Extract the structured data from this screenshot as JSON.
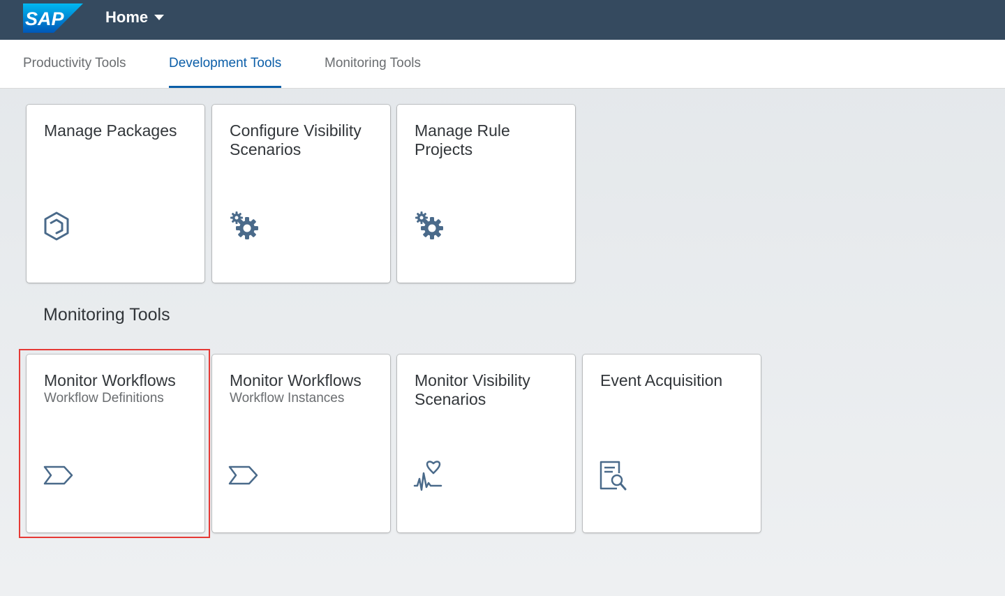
{
  "shell": {
    "logo_text": "SAP",
    "home_label": "Home",
    "brand_color": "#354a5f"
  },
  "tabs": [
    {
      "label": "Productivity Tools",
      "active": false
    },
    {
      "label": "Development Tools",
      "active": true
    },
    {
      "label": "Monitoring Tools",
      "active": false
    }
  ],
  "development_tiles": [
    {
      "title": "Manage Packages",
      "subtitle": "",
      "icon": "package-icon"
    },
    {
      "title": "Configure Visibility Scenarios",
      "subtitle": "",
      "icon": "gears-icon"
    },
    {
      "title": "Manage Rule Projects",
      "subtitle": "",
      "icon": "gears-icon"
    }
  ],
  "monitoring_section": {
    "title": "Monitoring Tools",
    "tiles": [
      {
        "title": "Monitor Workflows",
        "subtitle": "Workflow Definitions",
        "icon": "process-chevron-icon",
        "highlighted": true
      },
      {
        "title": "Monitor Workflows",
        "subtitle": "Workflow Instances",
        "icon": "process-chevron-icon",
        "highlighted": false
      },
      {
        "title": "Monitor Visibility Scenarios",
        "subtitle": "",
        "icon": "heart-pulse-icon",
        "highlighted": false
      },
      {
        "title": "Event Acquisition",
        "subtitle": "",
        "icon": "document-search-icon",
        "highlighted": false
      }
    ]
  },
  "colors": {
    "accent": "#0b5ea8",
    "icon": "#4a6a8a",
    "highlight": "#e53935"
  }
}
